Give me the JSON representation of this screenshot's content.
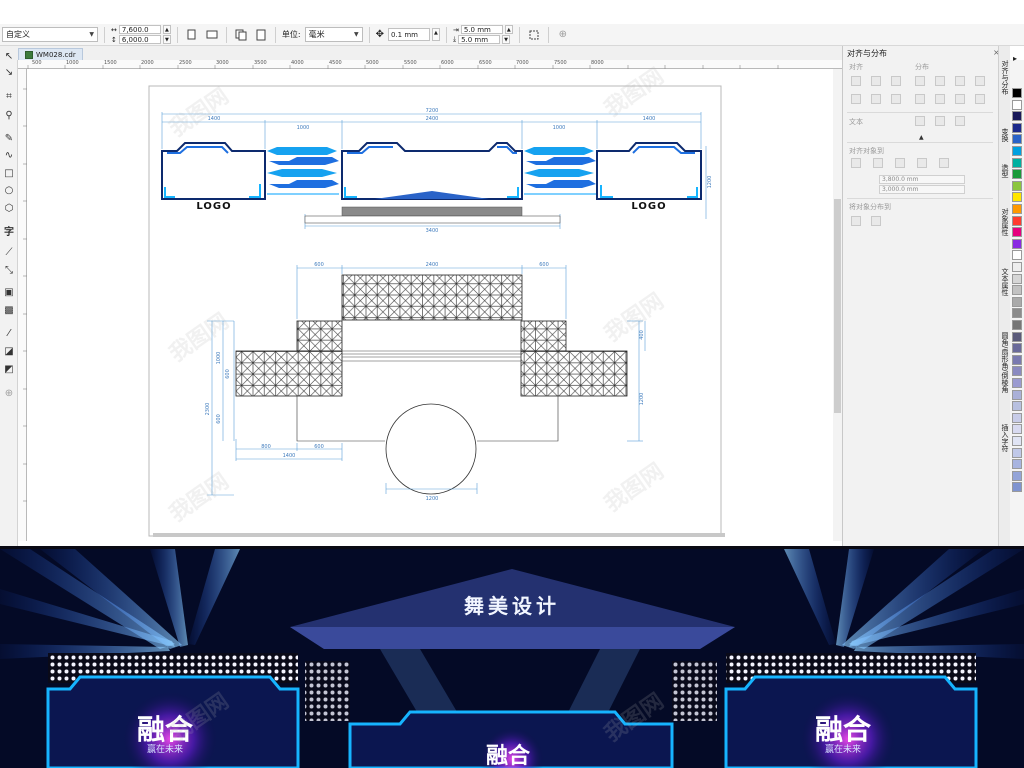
{
  "propbar": {
    "preset": "自定义",
    "width_value": "7,600.0 mm",
    "height_value": "6,000.0 mm",
    "units_label": "单位:",
    "units_value": "毫米",
    "nudge_value": "0.1 mm",
    "dup_x_value": "5.0 mm",
    "dup_y_value": "5.0 mm"
  },
  "tab": {
    "filename": "WM028.cdr"
  },
  "ruler": {
    "ticks": [
      "500",
      "1000",
      "1500",
      "2000",
      "2500",
      "3000",
      "3500",
      "4000",
      "4500",
      "5000",
      "5500",
      "6000",
      "6500",
      "7000",
      "7500",
      "8000"
    ]
  },
  "docker": {
    "title": "对齐与分布",
    "align_head": "对齐",
    "distribute_head": "分布",
    "text_head": "文本",
    "align_to_head": "对齐对象到",
    "x_value": "3,800.0 mm",
    "y_value": "3,000.0 mm",
    "spacing_head": "将对象分布到"
  },
  "vtabs": [
    "对齐与分布",
    "变换",
    "造型",
    "对象属性",
    "文本属性",
    "圆角/扇形角/倒棱角",
    "插入字符"
  ],
  "colors": {
    "palette": [
      "#000000",
      "#ffffff",
      "#1a1a5a",
      "#1c2a8c",
      "#2a63c8",
      "#00a0e0",
      "#00b0a0",
      "#1a9a3a",
      "#8cc63f",
      "#ffe600",
      "#ff9900",
      "#ff3b2f",
      "#e6007e",
      "#8a2be2",
      "#ffffff",
      "#eeeeee",
      "#d6d6d6",
      "#c2c2c2",
      "#aaaaaa",
      "#8c8c8c",
      "#777777",
      "#5a5a7a",
      "#6a6a9a",
      "#7a7ab0",
      "#8a8ac0",
      "#9a9ad0",
      "#aab0d8",
      "#b8c0e0",
      "#c8cce8",
      "#d8daf0",
      "#e0e4f4",
      "#c0c8e8",
      "#a8b4e0",
      "#94a4d8",
      "#8094d0"
    ],
    "stage_blue": "#1e6fe0",
    "stage_cyan": "#16b4ff",
    "drawing_blue": "#5a9fd8"
  },
  "drawing": {
    "front": {
      "dim_total": "7200",
      "dim_left": "1400",
      "dim_mid_left": "1000",
      "dim_center": "2400",
      "dim_mid_right": "1000",
      "dim_right": "1400",
      "dim_height": "1200",
      "dim_base": "3400",
      "logo_left": "LOGO",
      "logo_right": "LOGO"
    },
    "plan": {
      "dim_top_left": "600",
      "dim_top_center": "2400",
      "dim_top_right": "600",
      "dim_left_1000": "1000",
      "dim_left_600a": "600",
      "dim_left_2300": "2300",
      "dim_left_600b": "600",
      "dim_bottom_800": "800",
      "dim_bottom_600": "600",
      "dim_bottom_1400": "1400",
      "dim_circle": "1200",
      "dim_right_400": "400",
      "dim_right_1200": "1200"
    }
  },
  "render": {
    "header_text": "舞美设计",
    "logo_main": "融合",
    "logo_sub": "赢在未来"
  },
  "watermark": "我图网"
}
